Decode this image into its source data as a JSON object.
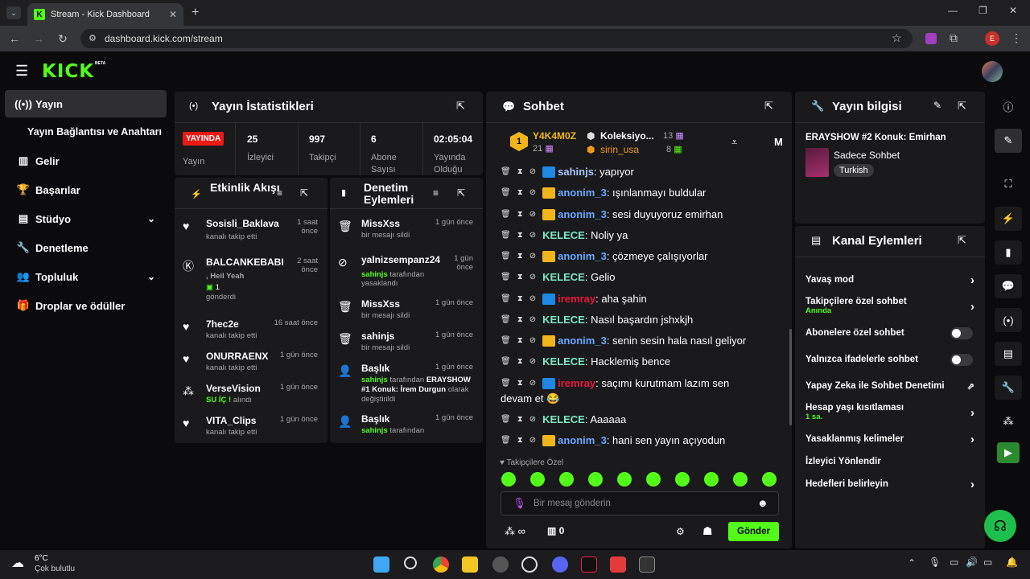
{
  "browser": {
    "tab_title": "Stream - Kick Dashboard",
    "url": "dashboard.kick.com/stream",
    "profile_initial": "E"
  },
  "header": {
    "logo": "KICK",
    "beta": "BETA"
  },
  "sidebar": {
    "items": [
      {
        "label": "Yayın",
        "icon": "broadcast-icon"
      },
      {
        "label": "Yayın Bağlantısı ve Anahtarı"
      },
      {
        "label": "Gelir",
        "icon": "chart-icon"
      },
      {
        "label": "Başarılar",
        "icon": "trophy-icon"
      },
      {
        "label": "Stüdyo",
        "icon": "studio-icon"
      },
      {
        "label": "Denetleme",
        "icon": "wrench-icon"
      },
      {
        "label": "Topluluk",
        "icon": "users-icon"
      },
      {
        "label": "Droplar ve ödüller",
        "icon": "gift-icon"
      }
    ]
  },
  "stats": {
    "title": "Yayın İstatistikleri",
    "live": "YAYINDA",
    "live_label": "Yayın",
    "items": [
      {
        "value": "25",
        "label": "İzleyici"
      },
      {
        "value": "997",
        "label": "Takipçi"
      },
      {
        "value": "6",
        "label": "Abone Sayısı"
      },
      {
        "value": "02:05:04",
        "label": "Yayında Olduğu"
      }
    ]
  },
  "activity": {
    "title": "Etkinlik Akışı",
    "items": [
      {
        "name": "Sosisli_Baklava",
        "time": "1 saat önce",
        "desc": "kanalı takip etti"
      },
      {
        "name": "BALCANKEBABI",
        "time": "2 saat önce",
        "line1": ", Heil Yeah",
        "line2": "1",
        "line3": "gönderdi"
      },
      {
        "name": "7hec2e",
        "time": "16 saat önce",
        "desc": "kanalı takip etti"
      },
      {
        "name": "ONURRAENX",
        "time": "1 gün önce",
        "desc": "kanalı takip etti"
      },
      {
        "name": "VerseVision",
        "time": "1 gün önce",
        "hl": "SU İÇ !",
        "desc": "alındı"
      },
      {
        "name": "VITA_Clips",
        "time": "1 gün önce",
        "desc": "kanalı takip etti"
      }
    ]
  },
  "moderation": {
    "title": "Denetim Eylemleri",
    "items": [
      {
        "name": "MissXss",
        "time": "1 gün önce",
        "desc": "bir mesajı sildi"
      },
      {
        "name": "yalnizsempanz24",
        "time": "1 gün önce",
        "by": "sahinjs",
        "desc": "tarafından yasaklandı"
      },
      {
        "name": "MissXss",
        "time": "1 gün önce",
        "desc": "bir mesajı sildi"
      },
      {
        "name": "sahinjs",
        "time": "1 gün önce",
        "desc": "bir mesajı sildi"
      },
      {
        "name": "Başlık",
        "time": "1 gün önce",
        "by": "sahinjs",
        "desc": "tarafından",
        "title_text": "ERAYSHOW #1 Konuk: İrem Durgun",
        "suffix": "olarak değiştirildi"
      },
      {
        "name": "Başlık",
        "time": "1 gün önce",
        "by": "sahinjs",
        "desc": "tarafından"
      }
    ]
  },
  "chat": {
    "title": "Sohbet",
    "top": {
      "user1": "Y4K4M0Z",
      "user1_rank": "1",
      "user1_count": "21",
      "user2": "Koleksiyo...",
      "user2_count": "13",
      "user3": "sirin_usa",
      "user3_count": "8",
      "extra": "M"
    },
    "messages": [
      {
        "user": "sahinjs",
        "color": "#a7c7ff",
        "text": ": yapıyor",
        "badge": "mod"
      },
      {
        "user": "anonim_3",
        "color": "#6aa7ff",
        "text": ": ışınlanmayı buldular",
        "badge": "crown"
      },
      {
        "user": "anonim_3",
        "color": "#6aa7ff",
        "text": ": sesi duyuyoruz emirhan",
        "badge": "crown"
      },
      {
        "user": "KELECE",
        "color": "#7ce8c5",
        "text": ": Noliy ya",
        "badge": ""
      },
      {
        "user": "anonim_3",
        "color": "#6aa7ff",
        "text": ": çözmeye çalışıyorlar",
        "badge": "crown"
      },
      {
        "user": "KELECE",
        "color": "#7ce8c5",
        "text": ": Gelio",
        "badge": ""
      },
      {
        "user": "iremray",
        "color": "#e8173c",
        "text": ": aha şahin",
        "badge": "mod"
      },
      {
        "user": "KELECE",
        "color": "#7ce8c5",
        "text": ": Nasıl başardın jshxkjh",
        "badge": ""
      },
      {
        "user": "anonim_3",
        "color": "#6aa7ff",
        "text": ": senin sesin hala nasıl geliyor",
        "badge": "crown"
      },
      {
        "user": "KELECE",
        "color": "#7ce8c5",
        "text": ": Hacklemiş bence",
        "badge": ""
      },
      {
        "user": "iremray",
        "color": "#e8173c",
        "text": ": saçımı kurutmam lazım sen",
        "badge": "mod"
      },
      {
        "user": "KELECE",
        "color": "#7ce8c5",
        "text": ": Aaaaaa",
        "badge": ""
      },
      {
        "user": "anonim_3",
        "color": "#6aa7ff",
        "text": ": hani sen yayın açıyodun",
        "badge": "crown"
      }
    ],
    "wrap_text": "devam et 😂",
    "followers_label": "Takipçilere Özel",
    "input_placeholder": "Bir mesaj gönderin",
    "points": "0",
    "infinity": "∞",
    "send": "Gönder"
  },
  "info": {
    "title": "Yayın bilgisi",
    "stream_title": "ERAYSHOW #2 Konuk: Emirhan",
    "category": "Sadece Sohbet",
    "tag": "Turkish"
  },
  "channel": {
    "title": "Kanal Eylemleri",
    "items": [
      {
        "label": "Yavaş mod",
        "kind": "chev"
      },
      {
        "label": "Takipçilere özel sohbet",
        "sub": "Anında",
        "kind": "chev"
      },
      {
        "label": "Abonelere özel sohbet",
        "kind": "toggle"
      },
      {
        "label": "Yalnızca ifadelerle sohbet",
        "kind": "toggle"
      },
      {
        "label": "Yapay Zeka ile Sohbet Denetimi",
        "kind": "ext"
      },
      {
        "label": "Hesap yaşı kısıtlaması",
        "sub": "1 sa.",
        "kind": "chev"
      },
      {
        "label": "Yasaklanmış kelimeler",
        "kind": "chev"
      },
      {
        "label": "İzleyici Yönlendir",
        "kind": "none"
      },
      {
        "label": "Hedefleri belirleyin",
        "kind": "chev"
      }
    ]
  },
  "taskbar": {
    "temp": "6°C",
    "weather": "Çok bulutlu"
  },
  "colors": {
    "accent": "#53fc18",
    "live": "#e91916",
    "panel": "#1a1a1c"
  }
}
